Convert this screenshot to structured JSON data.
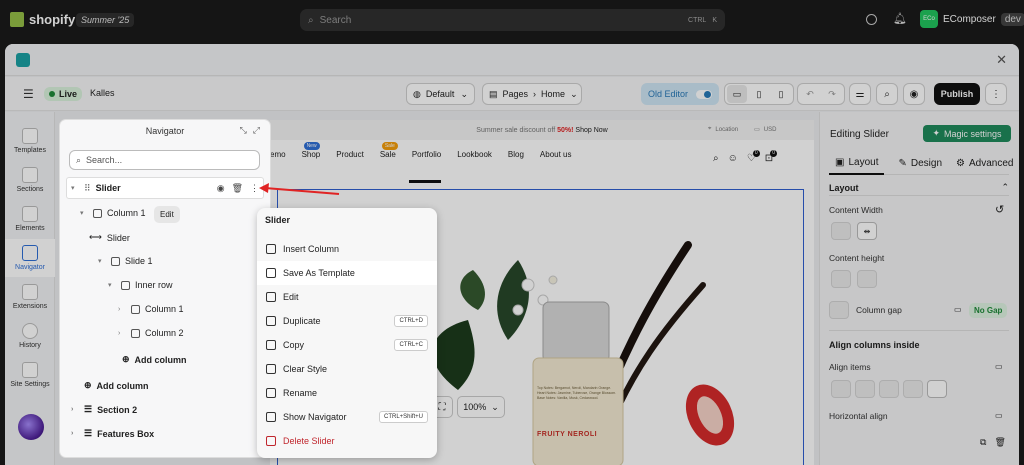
{
  "shopify": {
    "brand": "shopify",
    "edition": "Summer '25",
    "search_placeholder": "Search",
    "shortcut_ctrl": "CTRL",
    "shortcut_key": "K",
    "store_avatar": "ECo",
    "store_name": "EComposer",
    "store_tag": "dev"
  },
  "toolbar": {
    "status": "Live",
    "theme_name": "Kalles",
    "device_select": "Default",
    "page_type": "Pages",
    "page_name": "Home",
    "old_editor": "Old Editor",
    "publish": "Publish"
  },
  "rail": [
    {
      "label": "Templates",
      "icon": "templates-icon"
    },
    {
      "label": "Sections",
      "icon": "sections-icon"
    },
    {
      "label": "Elements",
      "icon": "elements-icon"
    },
    {
      "label": "Navigator",
      "icon": "navigator-icon"
    },
    {
      "label": "Extensions",
      "icon": "extensions-icon"
    },
    {
      "label": "History",
      "icon": "history-icon"
    },
    {
      "label": "Site Settings",
      "icon": "site-settings-icon"
    }
  ],
  "navigator": {
    "title": "Navigator",
    "search_placeholder": "Search...",
    "tree": [
      "Slider",
      "Column 1",
      "Slider",
      "Slide 1",
      "Inner row",
      "Column 1",
      "Column 2",
      "Add column",
      "Add column",
      "Section 2",
      "Features Box"
    ],
    "tooltip": "Edit"
  },
  "canvas": {
    "promo": "Summer sale discount off",
    "promo_pct": "50%!",
    "promo_link": "Shop Now",
    "location": "Location",
    "currency": "USD",
    "menu": [
      "emo",
      "Shop",
      "Product",
      "Sale",
      "Portfolio",
      "Lookbook",
      "Blog",
      "About us"
    ],
    "badge_new": "New",
    "badge_sale": "Sale",
    "zoom": "100%",
    "bottle_text": "Top Notes: Bergamot, Neroli, Mandarin Orange. Heart Notes: Jasmine, Tuberose, Orange Blossom. Base Notes: Vanilla, Musk, Cedarwood.",
    "bottle_label": "FRUITY NEROLI",
    "cart_count": "0",
    "wish_count": "0"
  },
  "context_menu": {
    "title": "Slider",
    "items": [
      {
        "label": "Insert Column",
        "icon": "insert-column-icon",
        "kbd": ""
      },
      {
        "label": "Save As Template",
        "icon": "save-template-icon",
        "kbd": ""
      },
      {
        "label": "Edit",
        "icon": "edit-icon",
        "kbd": ""
      },
      {
        "label": "Duplicate",
        "icon": "duplicate-icon",
        "kbd": "CTRL+D"
      },
      {
        "label": "Copy",
        "icon": "copy-icon",
        "kbd": "CTRL+C"
      },
      {
        "label": "Clear Style",
        "icon": "clear-style-icon",
        "kbd": ""
      },
      {
        "label": "Rename",
        "icon": "rename-icon",
        "kbd": ""
      },
      {
        "label": "Show Navigator",
        "icon": "show-navigator-icon",
        "kbd": "CTRL+Shift+U"
      },
      {
        "label": "Delete Slider",
        "icon": "delete-icon",
        "kbd": ""
      }
    ]
  },
  "right_panel": {
    "title": "Editing Slider",
    "magic": "Magic settings",
    "tabs": [
      "Layout",
      "Design",
      "Advanced"
    ],
    "section": "Layout",
    "content_width": "Content Width",
    "content_height": "Content height",
    "column_gap": "Column gap",
    "no_gap": "No Gap",
    "align_inside": "Align columns inside",
    "align_items": "Align items",
    "horizontal_align": "Horizontal align"
  },
  "colors": {
    "accent": "#2f6fd6",
    "live_green": "#1f8a3a",
    "magic_green": "#1f8a5c",
    "delete_red": "#c0262d",
    "arrow_red": "#e02424"
  }
}
